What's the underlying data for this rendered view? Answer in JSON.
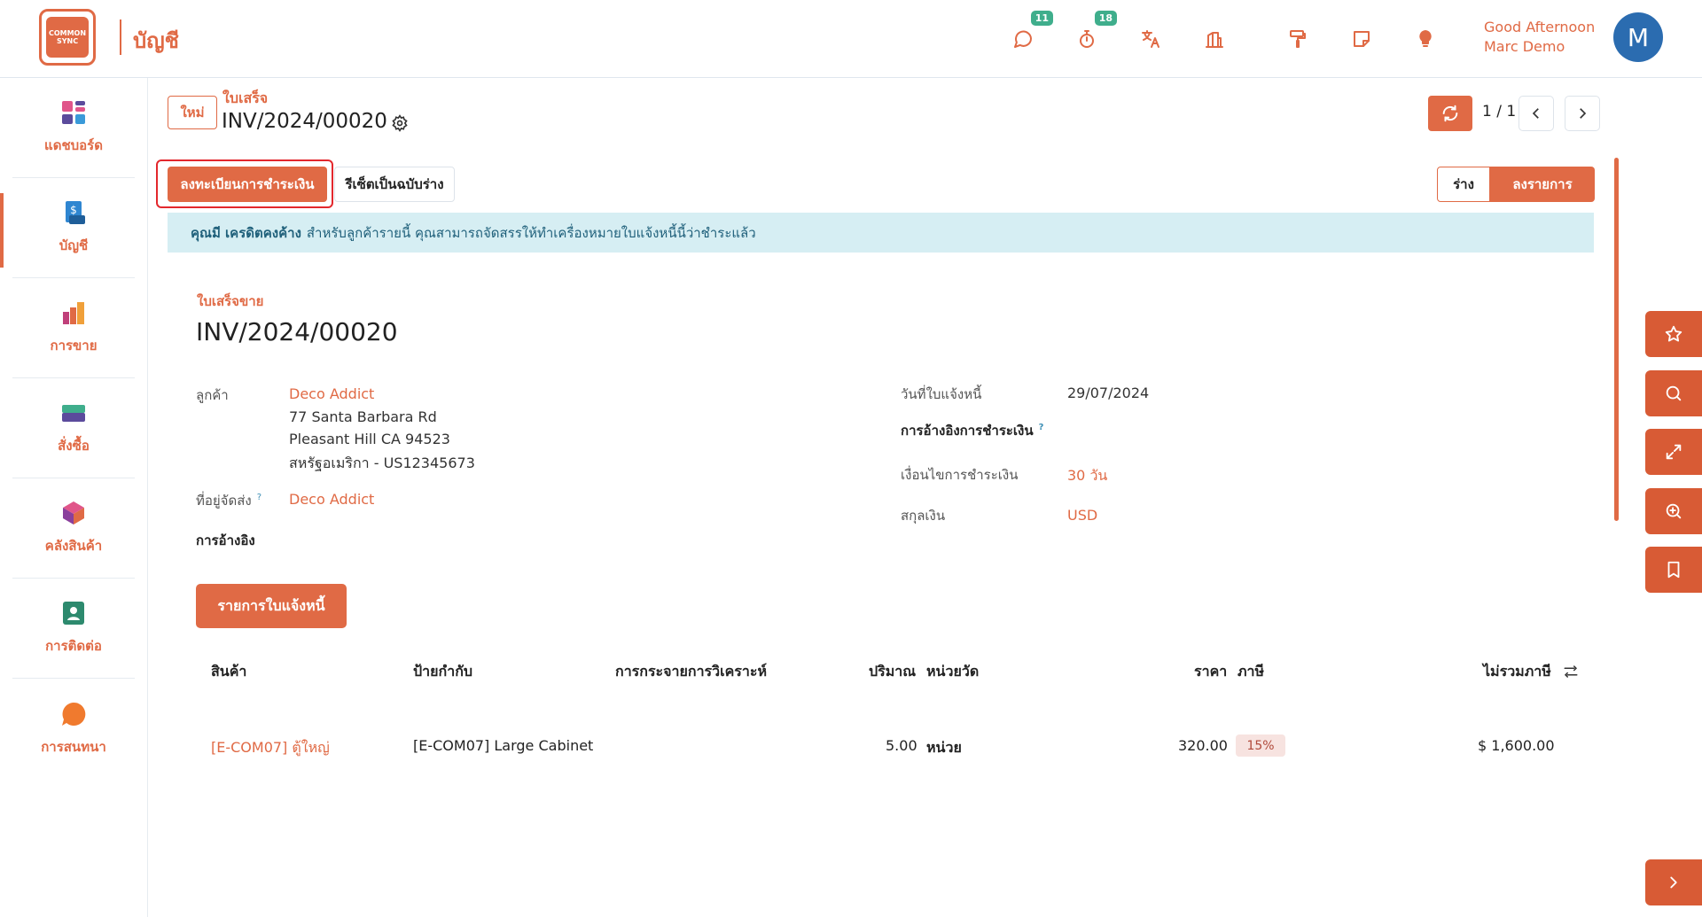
{
  "header": {
    "logo_text": "COMMON SYNC",
    "app_title": "บัญชี",
    "greeting": "Good Afternoon",
    "user_name": "Marc Demo",
    "avatar_letter": "M",
    "messages_badge": "11",
    "activities_badge": "18"
  },
  "sidebar": {
    "items": [
      {
        "label": "แดชบอร์ด"
      },
      {
        "label": "บัญชี"
      },
      {
        "label": "การขาย"
      },
      {
        "label": "สั่งซื้อ"
      },
      {
        "label": "คลังสินค้า"
      },
      {
        "label": "การติดต่อ"
      },
      {
        "label": "การสนทนา"
      }
    ]
  },
  "breadcrumb": {
    "new_label": "ใหม่",
    "parent": "ใบเสร็จ",
    "current": "INV/2024/00020"
  },
  "pager": {
    "text": "1 / 1"
  },
  "actions": {
    "register_payment": "ลงทะเบียนการชำระเงิน",
    "reset_to_draft": "รีเซ็ตเป็นฉบับร่าง",
    "status_draft": "ร่าง",
    "status_posted": "ลงรายการ"
  },
  "alert": {
    "bold": "คุณมี เครดิตคงค้าง",
    "text": "สำหรับลูกค้ารายนี้ คุณสามารถจัดสรรให้ทำเครื่องหมายใบแจ้งหนี้นี้ว่าชำระแล้ว"
  },
  "form": {
    "doc_type": "ใบเสร็จขาย",
    "doc_name": "INV/2024/00020",
    "customer_label": "ลูกค้า",
    "customer_name": "Deco Addict",
    "address1": "77 Santa Barbara Rd",
    "address2": "Pleasant Hill CA 94523",
    "address3": "สหรัฐอเมริกา - US12345673",
    "delivery_label": "ที่อยู่จัดส่ง",
    "delivery_value": "Deco Addict",
    "reference_label": "การอ้างอิง",
    "invoice_date_label": "วันที่ใบแจ้งหนี้",
    "invoice_date": "29/07/2024",
    "payment_ref_label": "การอ้างอิงการชำระเงิน",
    "payment_terms_label": "เงื่อนไขการชำระเงิน",
    "payment_terms": "30 วัน",
    "currency_label": "สกุลเงิน",
    "currency": "USD"
  },
  "tabs": {
    "invoice_lines": "รายการใบแจ้งหนี้"
  },
  "table": {
    "headers": {
      "product": "สินค้า",
      "label": "ป้ายกำกับ",
      "analytic": "การกระจายการวิเคราะห์",
      "quantity": "ปริมาณ",
      "uom": "หน่วยวัด",
      "price": "ราคา",
      "taxes": "ภาษี",
      "subtotal": "ไม่รวมภาษี"
    },
    "rows": [
      {
        "product": "[E-COM07] ตู้ใหญ่",
        "label": "[E-COM07] Large Cabinet",
        "quantity": "5.00",
        "uom": "หน่วย",
        "price": "320.00",
        "tax": "15%",
        "subtotal": "$ 1,600.00"
      }
    ]
  },
  "colors": {
    "accent": "#e06a45",
    "alert_bg": "#d6eef3",
    "avatar": "#2b6cb0",
    "badge": "#3fae8c"
  }
}
